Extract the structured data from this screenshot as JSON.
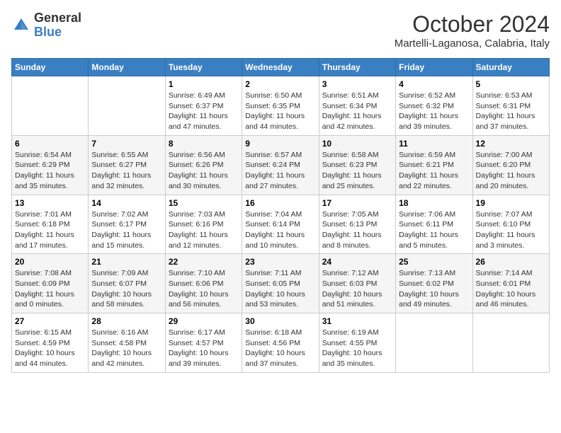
{
  "header": {
    "logo_general": "General",
    "logo_blue": "Blue",
    "month_title": "October 2024",
    "subtitle": "Martelli-Laganosa, Calabria, Italy"
  },
  "days_of_week": [
    "Sunday",
    "Monday",
    "Tuesday",
    "Wednesday",
    "Thursday",
    "Friday",
    "Saturday"
  ],
  "weeks": [
    [
      {
        "day": "",
        "info": ""
      },
      {
        "day": "",
        "info": ""
      },
      {
        "day": "1",
        "info": "Sunrise: 6:49 AM\nSunset: 6:37 PM\nDaylight: 11 hours and 47 minutes."
      },
      {
        "day": "2",
        "info": "Sunrise: 6:50 AM\nSunset: 6:35 PM\nDaylight: 11 hours and 44 minutes."
      },
      {
        "day": "3",
        "info": "Sunrise: 6:51 AM\nSunset: 6:34 PM\nDaylight: 11 hours and 42 minutes."
      },
      {
        "day": "4",
        "info": "Sunrise: 6:52 AM\nSunset: 6:32 PM\nDaylight: 11 hours and 39 minutes."
      },
      {
        "day": "5",
        "info": "Sunrise: 6:53 AM\nSunset: 6:31 PM\nDaylight: 11 hours and 37 minutes."
      }
    ],
    [
      {
        "day": "6",
        "info": "Sunrise: 6:54 AM\nSunset: 6:29 PM\nDaylight: 11 hours and 35 minutes."
      },
      {
        "day": "7",
        "info": "Sunrise: 6:55 AM\nSunset: 6:27 PM\nDaylight: 11 hours and 32 minutes."
      },
      {
        "day": "8",
        "info": "Sunrise: 6:56 AM\nSunset: 6:26 PM\nDaylight: 11 hours and 30 minutes."
      },
      {
        "day": "9",
        "info": "Sunrise: 6:57 AM\nSunset: 6:24 PM\nDaylight: 11 hours and 27 minutes."
      },
      {
        "day": "10",
        "info": "Sunrise: 6:58 AM\nSunset: 6:23 PM\nDaylight: 11 hours and 25 minutes."
      },
      {
        "day": "11",
        "info": "Sunrise: 6:59 AM\nSunset: 6:21 PM\nDaylight: 11 hours and 22 minutes."
      },
      {
        "day": "12",
        "info": "Sunrise: 7:00 AM\nSunset: 6:20 PM\nDaylight: 11 hours and 20 minutes."
      }
    ],
    [
      {
        "day": "13",
        "info": "Sunrise: 7:01 AM\nSunset: 6:18 PM\nDaylight: 11 hours and 17 minutes."
      },
      {
        "day": "14",
        "info": "Sunrise: 7:02 AM\nSunset: 6:17 PM\nDaylight: 11 hours and 15 minutes."
      },
      {
        "day": "15",
        "info": "Sunrise: 7:03 AM\nSunset: 6:16 PM\nDaylight: 11 hours and 12 minutes."
      },
      {
        "day": "16",
        "info": "Sunrise: 7:04 AM\nSunset: 6:14 PM\nDaylight: 11 hours and 10 minutes."
      },
      {
        "day": "17",
        "info": "Sunrise: 7:05 AM\nSunset: 6:13 PM\nDaylight: 11 hours and 8 minutes."
      },
      {
        "day": "18",
        "info": "Sunrise: 7:06 AM\nSunset: 6:11 PM\nDaylight: 11 hours and 5 minutes."
      },
      {
        "day": "19",
        "info": "Sunrise: 7:07 AM\nSunset: 6:10 PM\nDaylight: 11 hours and 3 minutes."
      }
    ],
    [
      {
        "day": "20",
        "info": "Sunrise: 7:08 AM\nSunset: 6:09 PM\nDaylight: 11 hours and 0 minutes."
      },
      {
        "day": "21",
        "info": "Sunrise: 7:09 AM\nSunset: 6:07 PM\nDaylight: 10 hours and 58 minutes."
      },
      {
        "day": "22",
        "info": "Sunrise: 7:10 AM\nSunset: 6:06 PM\nDaylight: 10 hours and 56 minutes."
      },
      {
        "day": "23",
        "info": "Sunrise: 7:11 AM\nSunset: 6:05 PM\nDaylight: 10 hours and 53 minutes."
      },
      {
        "day": "24",
        "info": "Sunrise: 7:12 AM\nSunset: 6:03 PM\nDaylight: 10 hours and 51 minutes."
      },
      {
        "day": "25",
        "info": "Sunrise: 7:13 AM\nSunset: 6:02 PM\nDaylight: 10 hours and 49 minutes."
      },
      {
        "day": "26",
        "info": "Sunrise: 7:14 AM\nSunset: 6:01 PM\nDaylight: 10 hours and 46 minutes."
      }
    ],
    [
      {
        "day": "27",
        "info": "Sunrise: 6:15 AM\nSunset: 4:59 PM\nDaylight: 10 hours and 44 minutes."
      },
      {
        "day": "28",
        "info": "Sunrise: 6:16 AM\nSunset: 4:58 PM\nDaylight: 10 hours and 42 minutes."
      },
      {
        "day": "29",
        "info": "Sunrise: 6:17 AM\nSunset: 4:57 PM\nDaylight: 10 hours and 39 minutes."
      },
      {
        "day": "30",
        "info": "Sunrise: 6:18 AM\nSunset: 4:56 PM\nDaylight: 10 hours and 37 minutes."
      },
      {
        "day": "31",
        "info": "Sunrise: 6:19 AM\nSunset: 4:55 PM\nDaylight: 10 hours and 35 minutes."
      },
      {
        "day": "",
        "info": ""
      },
      {
        "day": "",
        "info": ""
      }
    ]
  ]
}
